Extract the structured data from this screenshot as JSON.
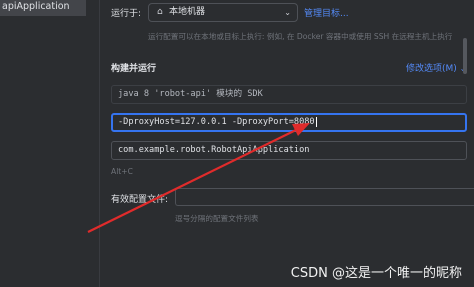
{
  "tree": {
    "selected_item": "apiApplication"
  },
  "run_on": {
    "label": "运行于:",
    "target": "本地机器",
    "home_icon": "home-icon",
    "manage_link": "管理目标...",
    "hint": "运行配置可以在本地或目标上执行: 例如, 在 Docker 容器中或使用 SSH 在远程主机上执行"
  },
  "build": {
    "section_title": "构建并运行",
    "modify_options": "修改选项(M)",
    "modify_icon": "chevron-down-icon",
    "sdk": "java 8 'robot-api' 模块的 SDK",
    "vm_options": "-DproxyHost=127.0.0.1 -DproxyPort=8080",
    "main_class": "com.example.robot.RobotApiApplication",
    "shortcut_hint": "Alt+C"
  },
  "env": {
    "label": "有效配置文件:",
    "value": "",
    "hint": "逗号分隔的配置文件列表"
  },
  "watermark": "CSDN @这是一个唯一的昵称",
  "colors": {
    "accent": "#3574f0",
    "link": "#548af7",
    "annotation_arrow": "#e02b2b"
  }
}
